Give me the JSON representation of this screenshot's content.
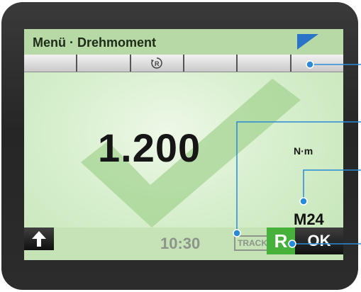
{
  "header": {
    "title": "Menü · Drehmoment",
    "corner_icon": "corner-flag-icon"
  },
  "toolbar": {
    "slots": 6,
    "icon": "r-circle-arrow-icon"
  },
  "display": {
    "torque_value": "1.200",
    "unit": "N·m",
    "thread_size": "M24",
    "status_icon": "checkmark-icon"
  },
  "footer": {
    "time": "10:30",
    "track_label": "TRACK",
    "r_button_label": "R",
    "ok_button_label": "OK",
    "up_icon": "arrow-up-icon"
  },
  "colors": {
    "screen_green": "#c5e3b6",
    "header_green": "#b7d9a6",
    "r_button": "#46b23c",
    "callout_line": "#2a8ad6",
    "corner_flag": "#2a73c9"
  }
}
